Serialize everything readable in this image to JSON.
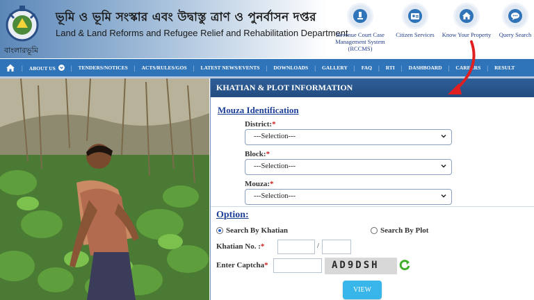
{
  "header": {
    "logo_text": "বাংলারভূমি",
    "title_bengali": "ভূমি ও ভূমি সংস্কার এবং উদ্বাস্তু ত্রাণ ও পুনর্বাসন দপ্তর",
    "title_english": "Land & Land Reforms and Refugee Relief and Rehabilitation Department",
    "quick_links": [
      {
        "label": "Revenue Court Case Management System (RCCMS)",
        "icon": "court-icon"
      },
      {
        "label": "Citizen Services",
        "icon": "id-card-icon"
      },
      {
        "label": "Know Your Property",
        "icon": "home-icon"
      },
      {
        "label": "Query Search",
        "icon": "chat-icon"
      }
    ]
  },
  "nav": {
    "items": [
      "ABOUT US",
      "TENDERS/NOTICES",
      "ACTS/RULES/GOS",
      "LATEST NEWS/EVENTS",
      "DOWNLOADS",
      "GALLERY",
      "FAQ",
      "RTI",
      "DASHBOARD",
      "CAREERS",
      "RESULT"
    ]
  },
  "form": {
    "panel_title": "KHATIAN & PLOT INFORMATION",
    "mouza_section": "Mouza Identification",
    "district_label": "District:",
    "block_label": "Block:",
    "mouza_label": "Mouza:",
    "select_placeholder": "---Selection---",
    "option_section": "Option",
    "option_colon": ":",
    "search_by_khatian": "Search By Khatian",
    "search_by_plot": "Search By Plot",
    "khatian_no_label": "Khatian No. :",
    "slash": "/",
    "captcha_label": "Enter Captcha",
    "captcha_text": "AD9DSH",
    "view_label": "VIEW",
    "required_mark": "*"
  },
  "colors": {
    "nav_blue": "#2f73b8",
    "panel_header": "#234c80",
    "link_blue": "#1d3f97",
    "view_button": "#38b6ea",
    "required_red": "#d01b1b",
    "annotation_arrow": "#e02020"
  }
}
